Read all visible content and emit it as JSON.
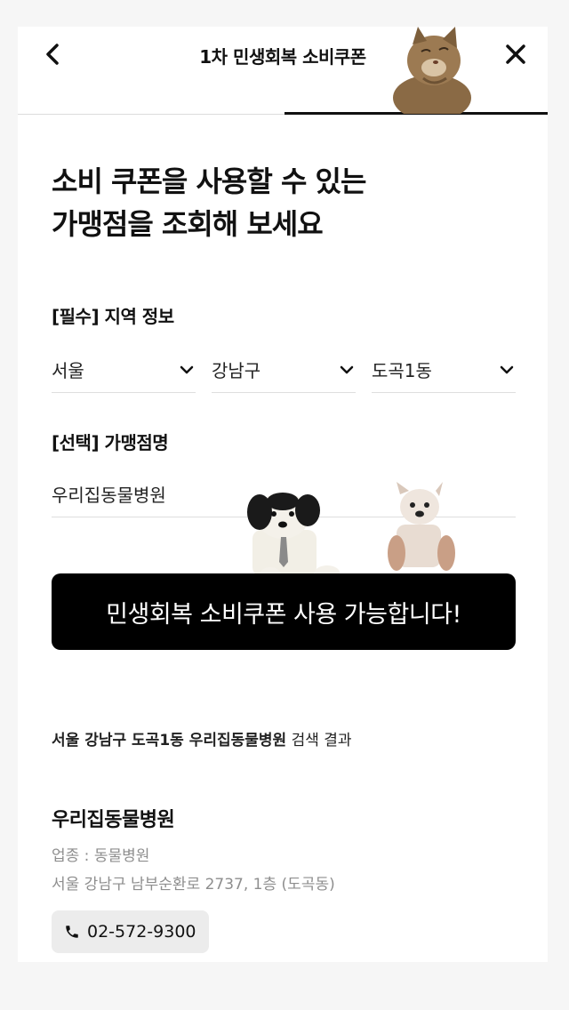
{
  "header": {
    "title": "1차 민생회복 소비쿠폰",
    "back_icon": "chevron-left-icon",
    "close_icon": "close-icon"
  },
  "headline": {
    "line1": "소비 쿠폰을 사용할 수 있는",
    "line2": "가맹점을 조회해 보세요"
  },
  "region": {
    "label": "[필수] 지역 정보",
    "city": "서울",
    "district": "강남구",
    "neighborhood": "도곡1동"
  },
  "store_search": {
    "label": "[선택] 가맹점명",
    "value": "우리집동물병원"
  },
  "submit_label": "민생회복 소비쿠폰 사용 가능합니다!",
  "result": {
    "query": "서울 강남구 도곡1동 우리집동물병원",
    "suffix": " 검색 결과"
  },
  "store": {
    "name": "우리집동물병원",
    "category": "업종 : 동물병원",
    "address": "서울 강남구 남부순환로 2737, 1층 (도곡동)",
    "phone": "02-572-9300",
    "phone_icon": "phone-icon"
  },
  "colors": {
    "accent": "#000000",
    "background": "#ffffff",
    "muted_text": "#8e8e8e",
    "chip_bg": "#ececec"
  }
}
